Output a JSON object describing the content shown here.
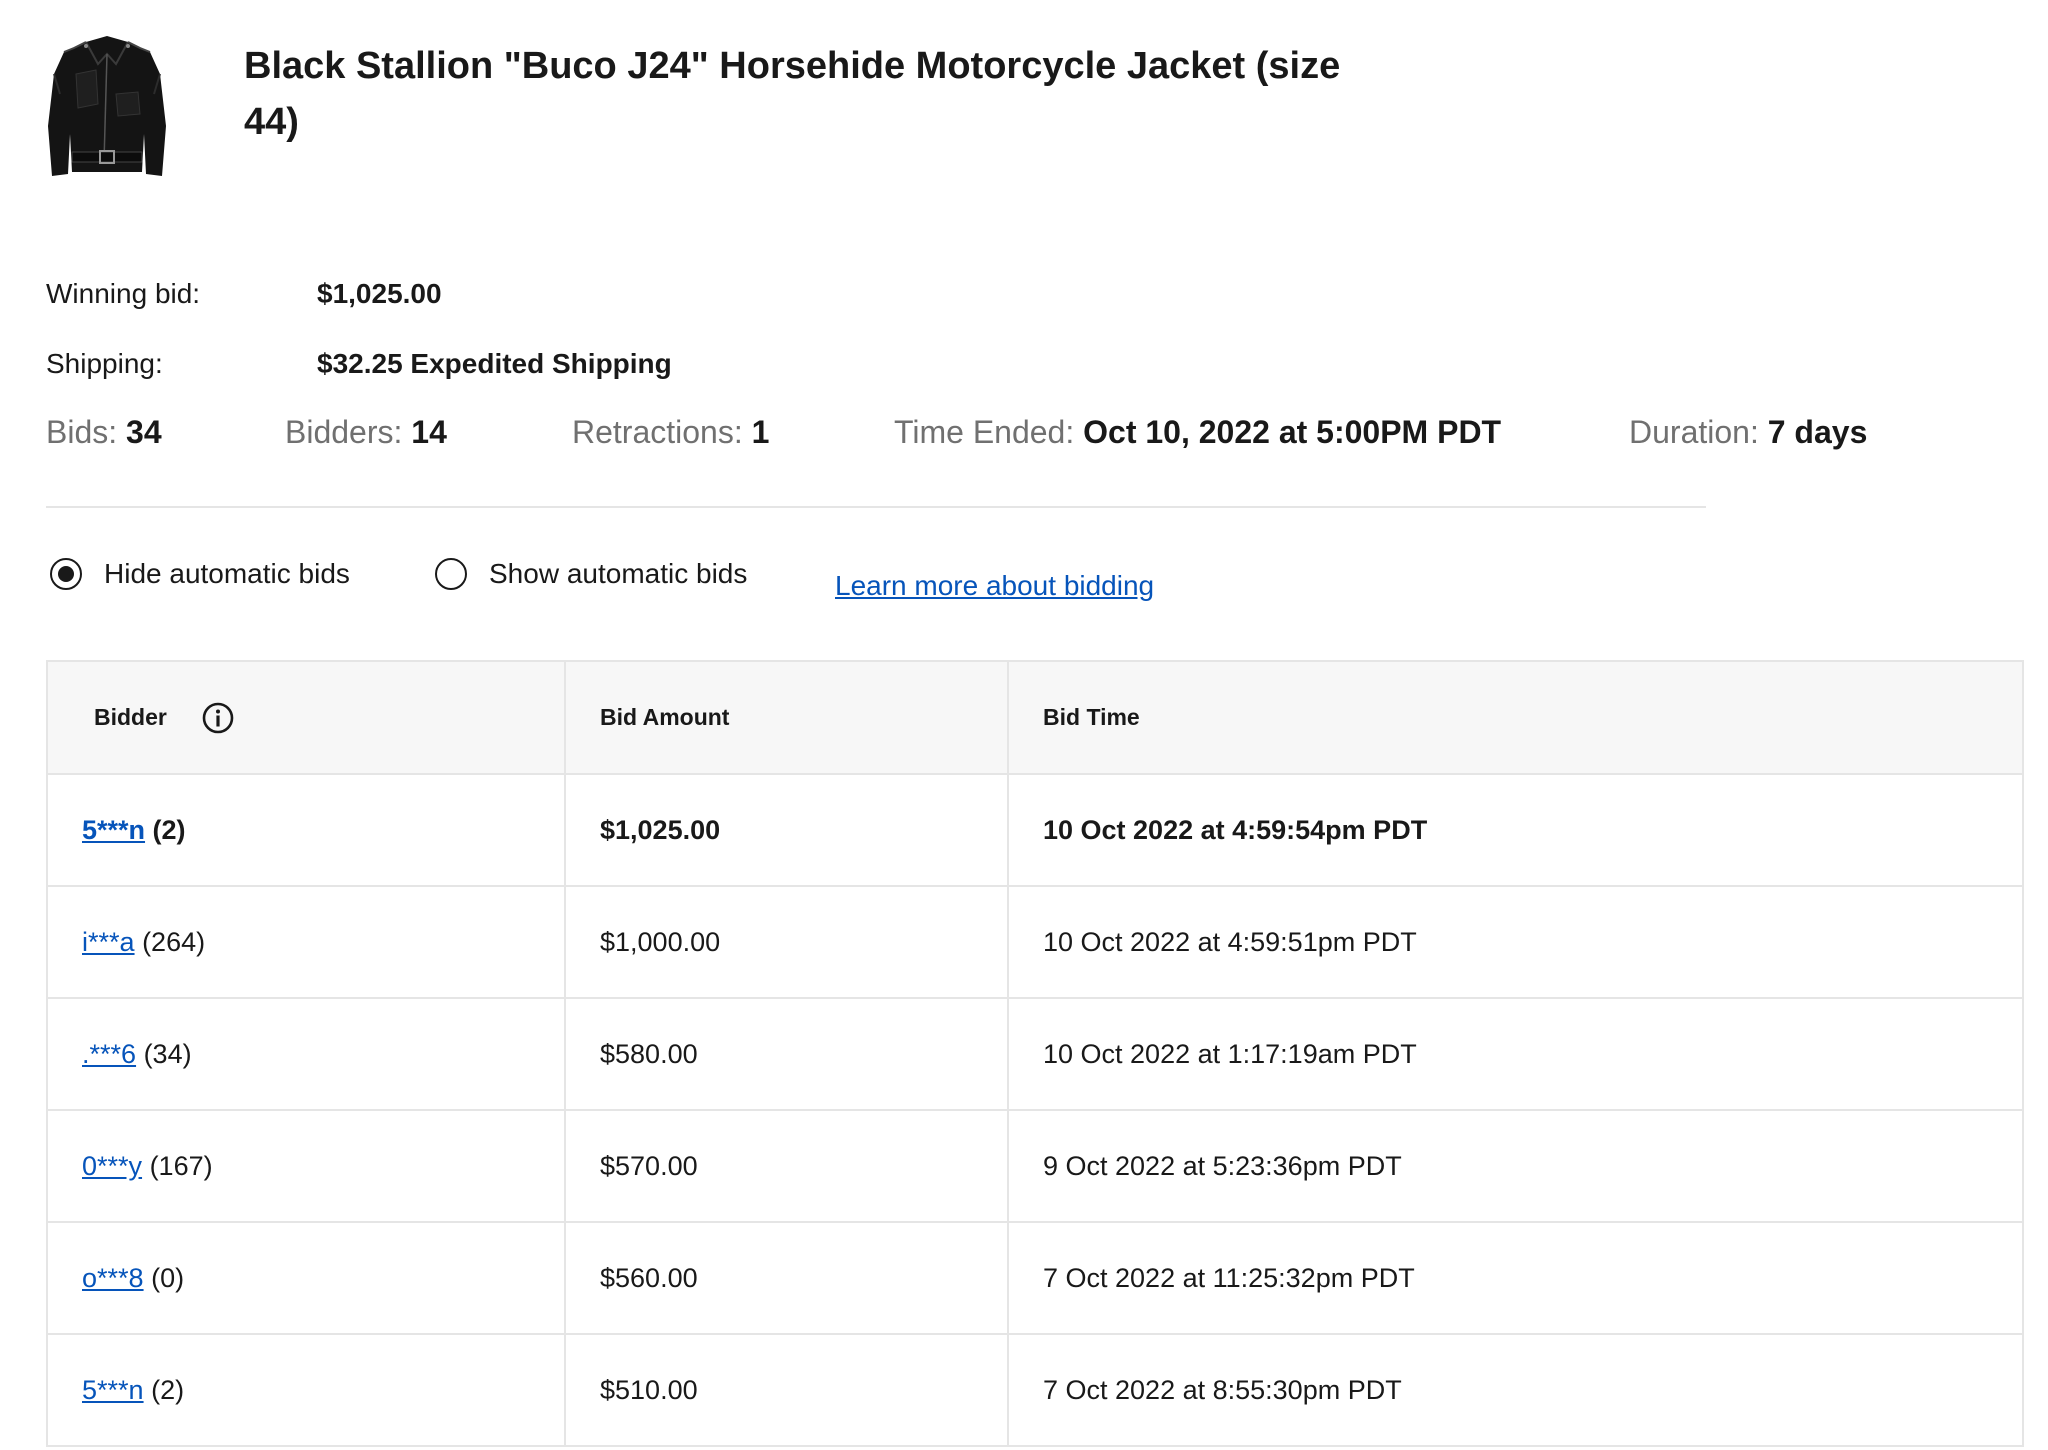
{
  "item": {
    "title": "Black Stallion \"Buco J24\" Horsehide Motorcycle Jacket (size 44)",
    "image_icon": "jacket-thumbnail"
  },
  "summary": {
    "winning_bid_label": "Winning bid:",
    "winning_bid_value": "$1,025.00",
    "shipping_label": "Shipping:",
    "shipping_value": "$32.25 Expedited Shipping"
  },
  "stats": {
    "bids_label": "Bids:",
    "bids_value": "34",
    "bidders_label": "Bidders:",
    "bidders_value": "14",
    "retractions_label": "Retractions:",
    "retractions_value": "1",
    "time_ended_label": "Time Ended:",
    "time_ended_value": "Oct 10, 2022 at 5:00PM PDT",
    "duration_label": "Duration:",
    "duration_value": "7 days"
  },
  "filters": {
    "hide_label": "Hide automatic bids",
    "show_label": "Show automatic bids",
    "selected": "hide",
    "learn_more": "Learn more about bidding"
  },
  "table": {
    "headers": {
      "bidder": "Bidder",
      "amount": "Bid Amount",
      "time": "Bid Time"
    },
    "rows": [
      {
        "bidder": "5***n",
        "feedback": "(2)",
        "amount": "$1,025.00",
        "time": "10 Oct 2022 at 4:59:54pm PDT",
        "winning": true
      },
      {
        "bidder": "i***a",
        "feedback": "(264)",
        "amount": "$1,000.00",
        "time": "10 Oct 2022 at 4:59:51pm PDT",
        "winning": false
      },
      {
        "bidder": ".***6",
        "feedback": "(34)",
        "amount": "$580.00",
        "time": "10 Oct 2022 at 1:17:19am PDT",
        "winning": false
      },
      {
        "bidder": "0***y",
        "feedback": "(167)",
        "amount": "$570.00",
        "time": "9 Oct 2022 at 5:23:36pm PDT",
        "winning": false
      },
      {
        "bidder": "o***8",
        "feedback": "(0)",
        "amount": "$560.00",
        "time": "7 Oct 2022 at 11:25:32pm PDT",
        "winning": false
      },
      {
        "bidder": "5***n",
        "feedback": "(2)",
        "amount": "$510.00",
        "time": "7 Oct 2022 at 8:55:30pm PDT",
        "winning": false
      }
    ]
  },
  "colors": {
    "link": "#0654ba",
    "muted_label": "#707070",
    "border": "#e5e5e5",
    "header_bg": "#f7f7f7"
  }
}
